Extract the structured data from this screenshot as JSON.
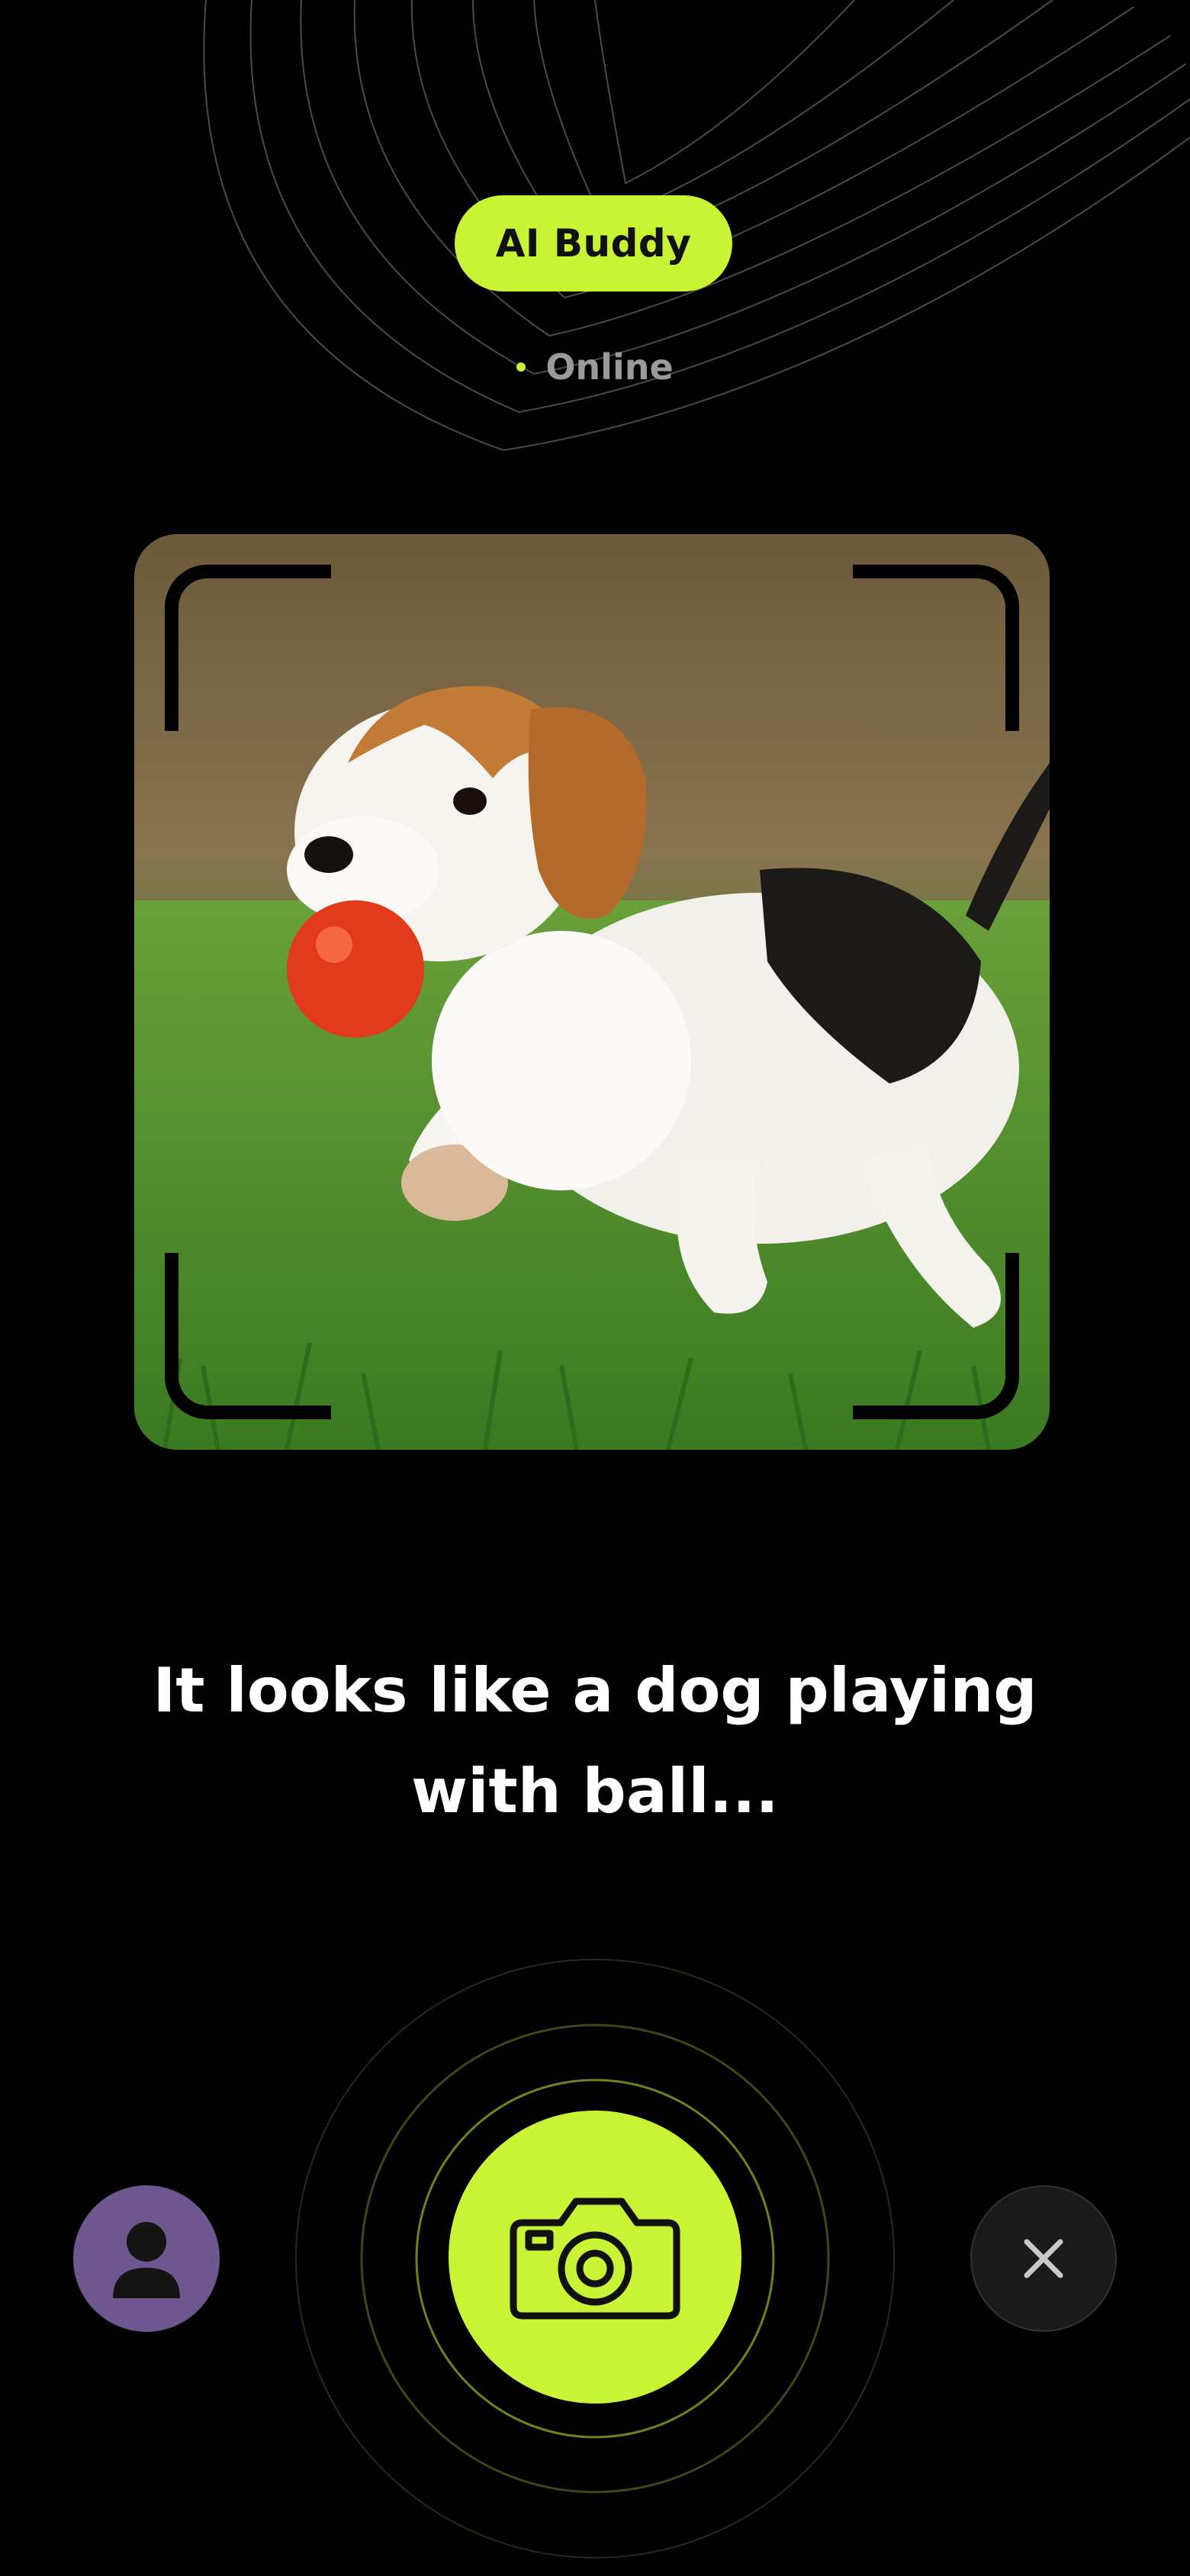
{
  "header": {
    "title": "AI Buddy",
    "status": "Online"
  },
  "colors": {
    "accent": "#C8F435",
    "avatar_bg": "#6E568E",
    "close_bg": "#1A1A1A"
  },
  "preview": {
    "image_subject": "beagle puppy running on grass with a red ball in its mouth"
  },
  "caption": "It looks like a dog playing with ball...",
  "controls": {
    "left_icon": "person-icon",
    "center_icon": "camera-icon",
    "right_icon": "close-icon"
  }
}
